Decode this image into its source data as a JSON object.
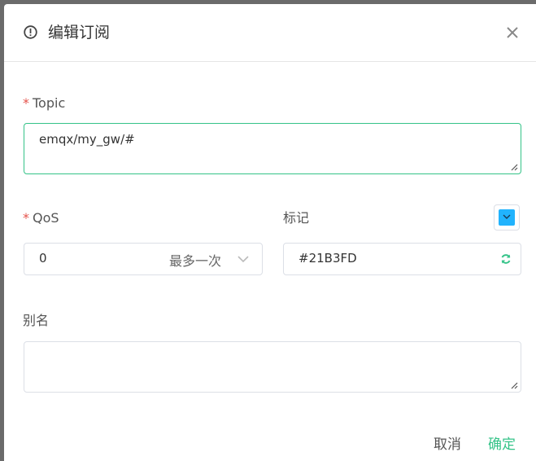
{
  "dialog": {
    "title": "编辑订阅"
  },
  "form": {
    "topic": {
      "label": "Topic",
      "required_mark": "*",
      "value": "emqx/my_gw/#"
    },
    "qos": {
      "label": "QoS",
      "required_mark": "*",
      "value": "0",
      "hint": "最多一次"
    },
    "mark": {
      "label": "标记",
      "value": "#21B3FD",
      "swatch_color": "#21B3FD"
    },
    "alias": {
      "label": "别名",
      "value": ""
    }
  },
  "footer": {
    "cancel_label": "取消",
    "confirm_label": "确定"
  },
  "colors": {
    "accent": "#34C388",
    "required": "#E5534B"
  },
  "icons": {
    "header": "warning-circle-icon",
    "close": "close-icon",
    "refresh": "refresh-icon",
    "chevron": "chevron-down-icon"
  }
}
